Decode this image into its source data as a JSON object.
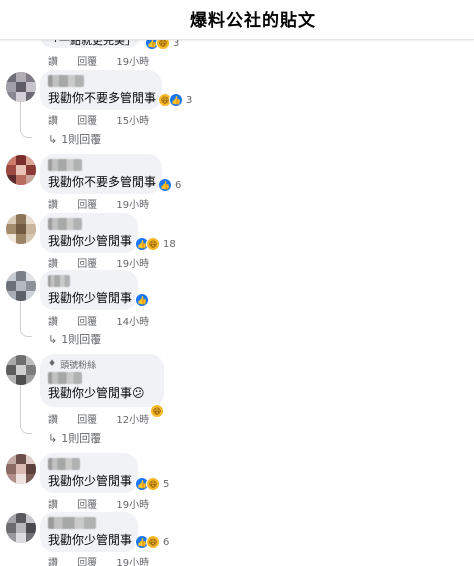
{
  "header": {
    "title": "爆料公社的貼文"
  },
  "top_partial": {
    "text": "「一點就更完美」",
    "react_count": "3"
  },
  "actions": {
    "like": "讚",
    "reply": "回覆"
  },
  "comments": [
    {
      "text": "我勸你不要多管閒事",
      "time": "15小時",
      "react_count": "3",
      "replies": "1則回覆"
    },
    {
      "text": "我勸你不要多管閒事",
      "time": "19小時",
      "react_count": "6"
    },
    {
      "text": "我勸你少管閒事",
      "time": "19小時",
      "react_count": "18"
    },
    {
      "text": "我勸你少管閒事",
      "time": "14小時",
      "replies": "1則回覆"
    },
    {
      "badge": "頭號粉絲",
      "text": "我勸你少管閒事😕",
      "time": "12小時",
      "replies": "1則回覆"
    },
    {
      "text": "我勸你少管閒事",
      "time": "19小時",
      "react_count": "5"
    },
    {
      "text": "我勸你少管閒事",
      "time": "19小時",
      "react_count": "6"
    }
  ],
  "top_actions_time": "19小時",
  "icons": [
    "like-icon",
    "haha-icon",
    "reply-arrow-icon",
    "diamond-badge-icon"
  ]
}
